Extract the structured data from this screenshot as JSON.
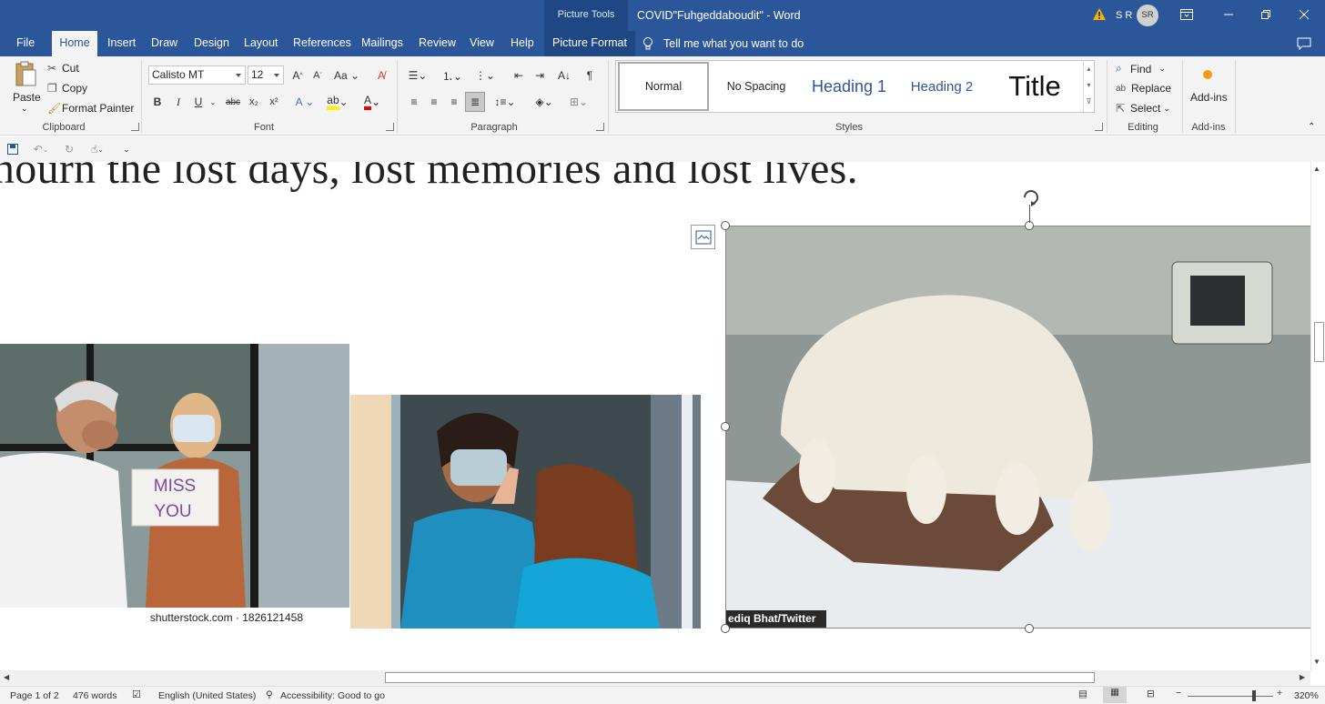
{
  "titlebar": {
    "context_group": "Picture Tools",
    "document_title": "COVID\"Fuhgeddaboudit\"  -  Word",
    "user_initials": "S R",
    "avatar_initials": "SR"
  },
  "tabs": [
    "File",
    "Home",
    "Insert",
    "Draw",
    "Design",
    "Layout",
    "References",
    "Mailings",
    "Review",
    "View",
    "Help",
    "Picture Format"
  ],
  "tell_me": "Tell me what you want to do",
  "ribbon": {
    "clipboard": {
      "paste": "Paste",
      "cut": "Cut",
      "copy": "Copy",
      "format_painter": "Format Painter",
      "label": "Clipboard"
    },
    "font": {
      "family": "Calisto MT",
      "size": "12",
      "bold": "B",
      "italic": "I",
      "underline": "U",
      "strike": "abc",
      "label": "Font"
    },
    "paragraph": {
      "label": "Paragraph"
    },
    "styles": {
      "items": [
        "Normal",
        "No Spacing",
        "Heading 1",
        "Heading 2",
        "Title"
      ],
      "label": "Styles"
    },
    "editing": {
      "find": "Find",
      "replace": "Replace",
      "select": "Select",
      "label": "Editing"
    },
    "addins": {
      "button": "Add-ins",
      "label": "Add-ins"
    }
  },
  "document": {
    "visible_text": "nourn the lost days, lost memories and lost lives.",
    "photo1_caption": "shutterstock.com · 1826121458",
    "photo1_sign": "MISS YOU",
    "photo3_credit": "ediq Bhat/Twitter"
  },
  "status": {
    "page": "Page 1 of 2",
    "words": "476 words",
    "language": "English (United States)",
    "accessibility": "Accessibility: Good to go",
    "zoom": "320%"
  },
  "colors": {
    "ribbon_blue": "#2b579a",
    "context_blue": "#1e4784"
  }
}
